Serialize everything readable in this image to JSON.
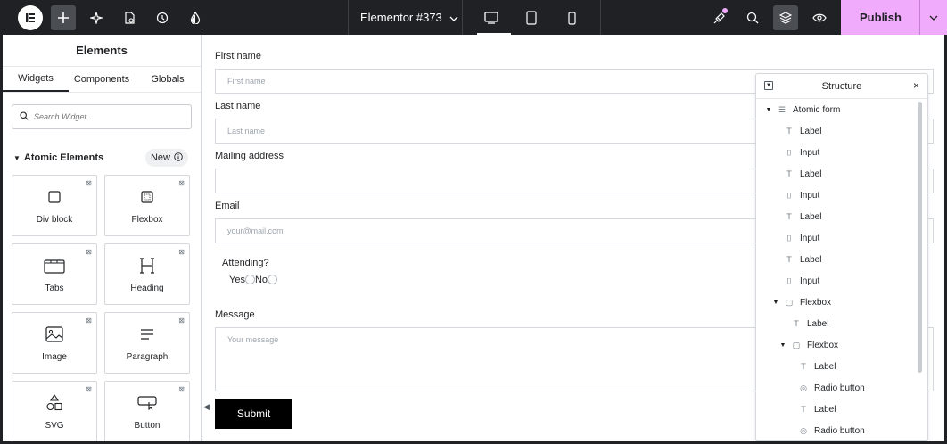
{
  "topbar": {
    "title": "Elementor #373",
    "publish_label": "Publish",
    "icons": [
      "elementor-logo-icon",
      "plus-icon",
      "sparkle-icon",
      "page-settings-icon",
      "history-icon",
      "theme-drop-icon",
      "desktop-icon",
      "tablet-icon",
      "mobile-icon",
      "notifications-icon",
      "search-icon",
      "structure-icon",
      "preview-eye-icon",
      "chevron-down-icon"
    ],
    "accent": "#f0abfc"
  },
  "panel": {
    "title": "Elements",
    "tabs": [
      "Widgets",
      "Components",
      "Globals"
    ],
    "active_tab": "Widgets",
    "search_placeholder": "Search Widget...",
    "section": "Atomic Elements",
    "new_badge": "New",
    "widgets": [
      "Div block",
      "Flexbox",
      "Tabs",
      "Heading",
      "Image",
      "Paragraph",
      "SVG",
      "Button"
    ]
  },
  "form": {
    "first_name_label": "First name",
    "first_name_placeholder": "First name",
    "last_name_label": "Last name",
    "last_name_placeholder": "Last name",
    "mailing_label": "Mailing address",
    "mailing_placeholder": "",
    "email_label": "Email",
    "email_placeholder": "your@mail.com",
    "attending_label": "Attending?",
    "yes_label": "Yes",
    "no_label": "No",
    "message_label": "Message",
    "message_placeholder": "Your message",
    "submit_label": "Submit"
  },
  "structure": {
    "title": "Structure",
    "items": [
      {
        "label": "Atomic form"
      },
      {
        "label": "Label"
      },
      {
        "label": "Input"
      },
      {
        "label": "Label"
      },
      {
        "label": "Input"
      },
      {
        "label": "Label"
      },
      {
        "label": "Input"
      },
      {
        "label": "Label"
      },
      {
        "label": "Input"
      },
      {
        "label": "Flexbox"
      },
      {
        "label": "Label"
      },
      {
        "label": "Flexbox"
      },
      {
        "label": "Label"
      },
      {
        "label": "Radio button"
      },
      {
        "label": "Label"
      },
      {
        "label": "Radio button"
      }
    ]
  }
}
